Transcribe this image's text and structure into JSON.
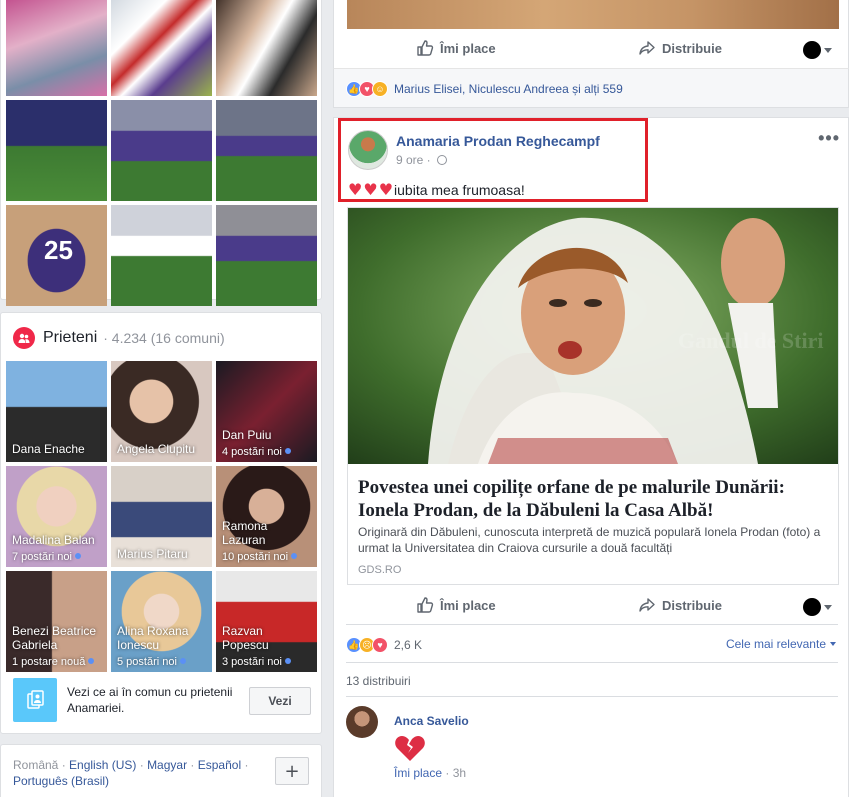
{
  "photos": {
    "tiles": [
      {
        "caption": ""
      },
      {
        "caption": ""
      },
      {
        "caption": ""
      },
      {
        "caption": ""
      },
      {
        "caption": ""
      },
      {
        "caption": ""
      },
      {
        "caption": "25"
      },
      {
        "caption": ""
      },
      {
        "caption": ""
      }
    ]
  },
  "friends": {
    "title": "Prieteni",
    "count": "· 4.234 (16 comuni)",
    "items": [
      {
        "name": "Dana Enache",
        "posts": ""
      },
      {
        "name": "Angela Clupitu",
        "posts": ""
      },
      {
        "name": "Dan Puiu",
        "posts": "4 postări noi"
      },
      {
        "name": "Madalina Balan",
        "posts": "7 postări noi"
      },
      {
        "name": "Marius Pitaru",
        "posts": ""
      },
      {
        "name": "Ramona Lazuran",
        "posts": "10 postări noi"
      },
      {
        "name": "Benezi Beatrice Gabriela",
        "posts": "1 postare nouă"
      },
      {
        "name": "Alina Roxana Ionescu",
        "posts": "5 postări noi"
      },
      {
        "name": "Razvan Popescu",
        "posts": "3 postări noi"
      }
    ],
    "cta_text": "Vezi ce ai în comun cu prietenii Anamariei.",
    "cta_button": "Vezi"
  },
  "languages": {
    "current": "Română",
    "others": [
      "English (US)",
      "Magyar",
      "Español",
      "Português (Brasil)"
    ],
    "add_button": "+"
  },
  "prev_post": {
    "like_label": "Îmi place",
    "share_label": "Distribuie",
    "reactions_text": "Marius Elisei, Niculescu Andreea și alți 559"
  },
  "post": {
    "author": "Anamaria Prodan Reghecampf",
    "time": "9 ore ·",
    "text": "iubita mea frumoasa!",
    "more": "•••",
    "link": {
      "watermark": "Gandul de Stiri",
      "title": "Povestea unei copilițe orfane de pe malurile Dunării: Ionela Prodan, de la Dăbuleni la Casa Albă!",
      "description": "Originară din Dăbuleni, cunoscuta interpretă de muzică populară Ionela Prodan (foto) a urmat la Universitatea din Craiova cursurile a două facultăți",
      "domain": "GDS.RO"
    },
    "like_label": "Îmi place",
    "share_label": "Distribuie",
    "reactions_count": "2,6 K",
    "sort_label": "Cele mai relevante",
    "shares": "13 distribuiri",
    "comment": {
      "author": "Anca Savelio",
      "like_label": "Îmi place",
      "time": "· 3h"
    }
  },
  "colors": {
    "link": "#365899",
    "highlight": "#e0202a",
    "friends_icon": "#f02849"
  }
}
